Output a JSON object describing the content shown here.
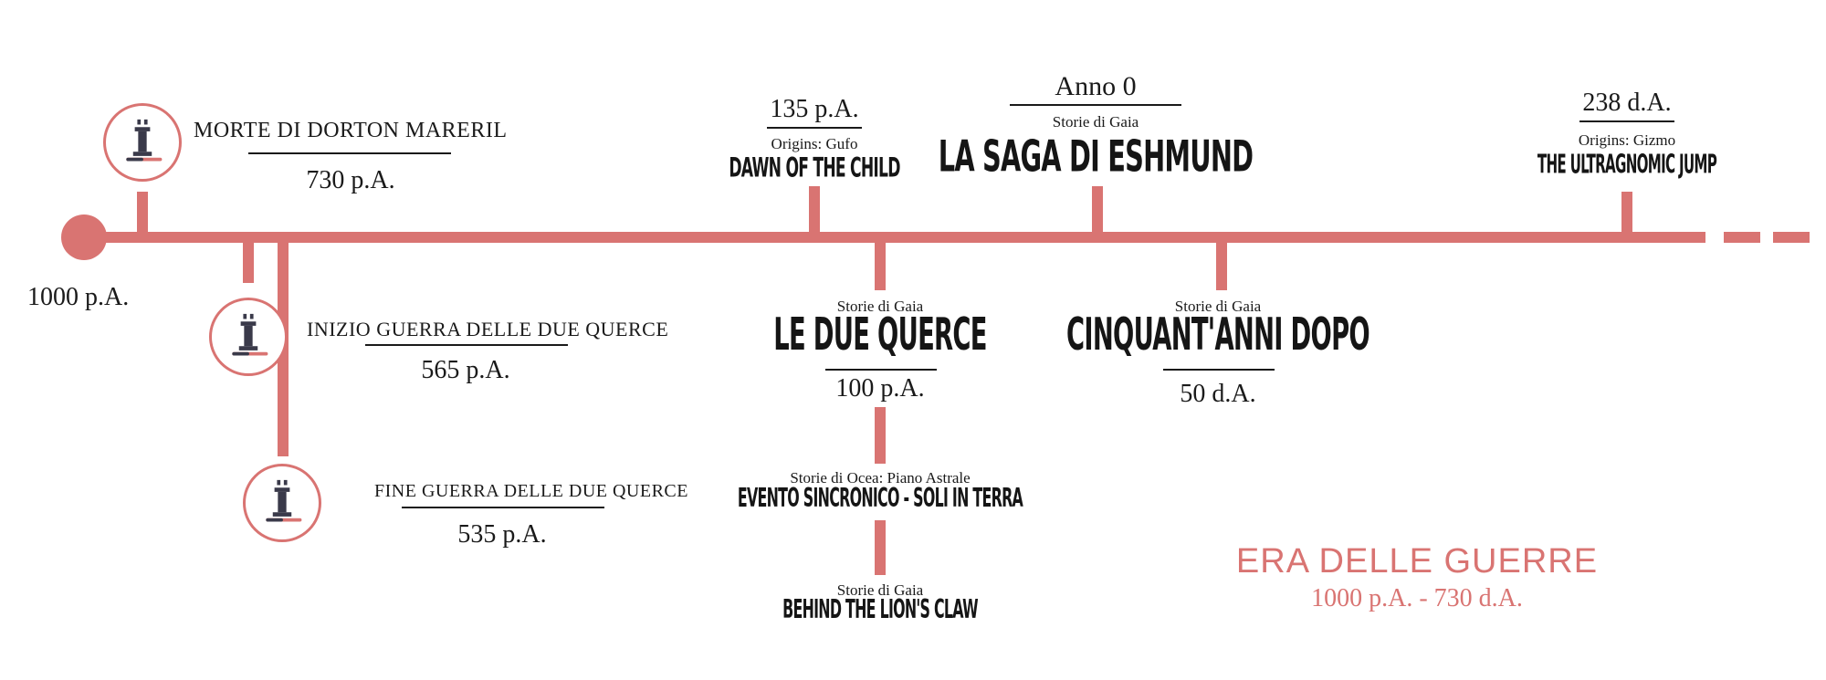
{
  "timeline": {
    "start_label": "1000 p.A.",
    "colors": {
      "accent": "#d97472",
      "text": "#1a1a1a",
      "icon": "#3a3a4a"
    }
  },
  "events_above": [
    {
      "id": "dorton",
      "title": "MORTE DI DORTON MARERIL",
      "date": "730 p.A.",
      "icon": "pillar-icon"
    },
    {
      "id": "child",
      "date": "135 p.A.",
      "series": "Origins: Gufo",
      "book": "DAWN OF THE CHILD"
    },
    {
      "id": "eshmund",
      "date": "Anno 0",
      "series": "Storie di Gaia",
      "book": "LA SAGA DI ESHMUND"
    },
    {
      "id": "jump",
      "date": "238 d.A.",
      "series": "Origins: Gizmo",
      "book": "THE ULTRAGNOMIC JUMP"
    }
  ],
  "events_below": [
    {
      "id": "inizio",
      "title": "INIZIO GUERRA DELLE DUE QUERCE",
      "date": "565 p.A.",
      "icon": "pillar-icon"
    },
    {
      "id": "fine",
      "title": "FINE GUERRA DELLE DUE QUERCE",
      "date": "535 p.A.",
      "icon": "pillar-icon"
    },
    {
      "id": "querce",
      "series": "Storie di Gaia",
      "book": "LE DUE QUERCE",
      "date": "100 p.A."
    },
    {
      "id": "sincronico",
      "series": "Storie di Ocea: Piano Astrale",
      "book": "EVENTO SINCRONICO - SOLI IN TERRA"
    },
    {
      "id": "lion",
      "series": "Storie di Gaia",
      "book": "BEHIND THE LION'S CLAW"
    },
    {
      "id": "cinquant",
      "series": "Storie di Gaia",
      "book": "CINQUANT'ANNI DOPO",
      "date": "50 d.A."
    }
  ],
  "era": {
    "title": "ERA DELLE GUERRE",
    "range": "1000 p.A. - 730 d.A."
  }
}
